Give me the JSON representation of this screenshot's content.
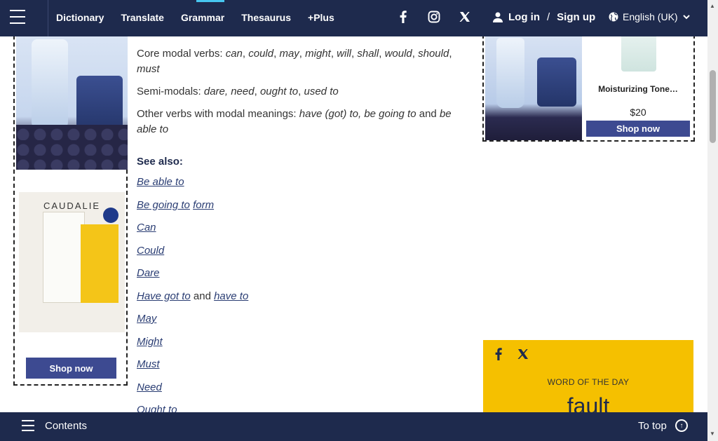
{
  "nav": {
    "links": [
      "Dictionary",
      "Translate",
      "Grammar",
      "Thesaurus",
      "+Plus"
    ],
    "active": "Grammar",
    "social_icons": [
      "facebook-icon",
      "instagram-icon",
      "x-icon"
    ],
    "login": "Log in",
    "signup": "Sign up",
    "language": "English (UK)"
  },
  "left_ad": {
    "brand": "CAUDALIE",
    "shop_label": "Shop now"
  },
  "content": {
    "core_label": "Core modal verbs: ",
    "core_verbs": [
      "can",
      "could",
      "may",
      "might",
      "will",
      "shall",
      "would",
      "should",
      "must"
    ],
    "semi_label": "Semi-modals: ",
    "semi_verbs": [
      "dare, need",
      "ought to",
      "used to"
    ],
    "other_label": "Other verbs with modal meanings: ",
    "other_verbs_1": "have (got) to, be going to",
    "other_and": " and ",
    "other_verbs_2": "be able to"
  },
  "see_also": {
    "heading": "See also:",
    "items": [
      "Be able to",
      "Be going to",
      "form",
      "Can",
      "Could",
      "Dare",
      "Have got to",
      "and",
      "have to",
      "May",
      "Might",
      "Must",
      "Need",
      "Ought to"
    ]
  },
  "right_ad": {
    "product_name": "Moisturizing Tone…",
    "price": "$20",
    "shop_label": "Shop now"
  },
  "word_of_the_day": {
    "label": "WORD OF THE DAY",
    "word": "fault",
    "social_icons": [
      "facebook-icon",
      "x-icon"
    ]
  },
  "bottom": {
    "contents": "Contents",
    "to_top": "To top"
  }
}
